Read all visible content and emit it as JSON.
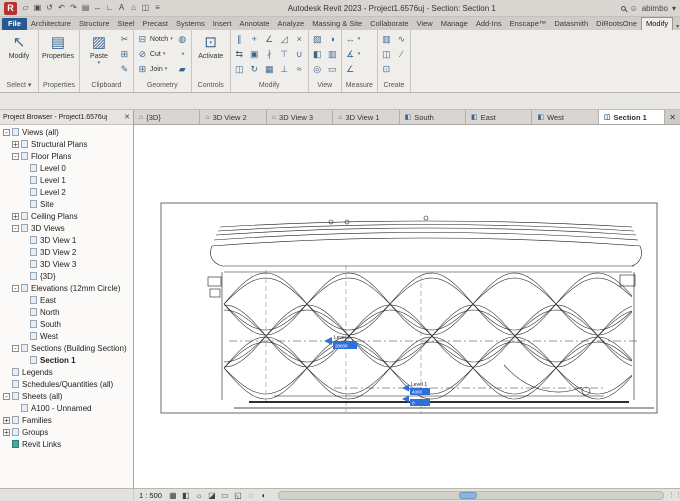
{
  "title_bar": {
    "title": "Autodesk Revit 2023 - Project1.6576uj - Section: Section 1",
    "user": "abimbo",
    "qat_icons": [
      {
        "name": "open-icon",
        "glyph": "▱"
      },
      {
        "name": "save-icon",
        "glyph": "▣"
      },
      {
        "name": "sync-icon",
        "glyph": "↺"
      },
      {
        "name": "undo-icon",
        "glyph": "↶"
      },
      {
        "name": "redo-icon",
        "glyph": "↷"
      },
      {
        "name": "print-icon",
        "glyph": "▤"
      },
      {
        "name": "measure-icon",
        "glyph": "↔"
      },
      {
        "name": "aligned-dimension-icon",
        "glyph": "∟"
      },
      {
        "name": "text-icon",
        "glyph": "A"
      },
      {
        "name": "3d-view-icon",
        "glyph": "⌂"
      },
      {
        "name": "section-icon",
        "glyph": "◫"
      },
      {
        "name": "thin-lines-icon",
        "glyph": "≡"
      }
    ]
  },
  "ribbon": {
    "active_tab": "Modify",
    "tabs": [
      {
        "label": "File",
        "file": true
      },
      {
        "label": "Architecture"
      },
      {
        "label": "Structure"
      },
      {
        "label": "Steel"
      },
      {
        "label": "Precast"
      },
      {
        "label": "Systems"
      },
      {
        "label": "Insert"
      },
      {
        "label": "Annotate"
      },
      {
        "label": "Analyze"
      },
      {
        "label": "Massing & Site"
      },
      {
        "label": "Collaborate"
      },
      {
        "label": "View"
      },
      {
        "label": "Manage"
      },
      {
        "label": "Add-Ins"
      },
      {
        "label": "Enscape™"
      },
      {
        "label": "Datasmith"
      },
      {
        "label": "DiRootsOne"
      },
      {
        "label": "Modify"
      }
    ],
    "panels": [
      {
        "label": "Select",
        "arrow": true,
        "columns": [
          {
            "type": "big",
            "tools": [
              {
                "name": "modify-tool",
                "glyph": "↖",
                "label": "Modify"
              }
            ]
          }
        ]
      },
      {
        "label": "Properties",
        "columns": [
          {
            "type": "big",
            "tools": [
              {
                "name": "properties-tool",
                "glyph": "▤",
                "label": "Properties"
              }
            ]
          }
        ]
      },
      {
        "label": "Clipboard",
        "columns": [
          {
            "type": "big",
            "tools": [
              {
                "name": "paste-tool",
                "glyph": "▨",
                "label": "Paste",
                "arrow": true
              }
            ]
          },
          {
            "type": "stack",
            "tools": [
              {
                "name": "cut-icon",
                "glyph": "✂"
              },
              {
                "name": "copy-icon",
                "glyph": "⊞"
              },
              {
                "name": "match-type-icon",
                "glyph": "✎"
              }
            ]
          }
        ]
      },
      {
        "label": "Geometry",
        "columns": [
          {
            "type": "stack",
            "tools": [
              {
                "name": "notch-tool",
                "glyph": "⊟",
                "label": "Notch",
                "arrow": true
              },
              {
                "name": "cut-geometry-tool",
                "glyph": "⊘",
                "label": "Cut",
                "arrow": true
              },
              {
                "name": "join-geometry-tool",
                "glyph": "⊞",
                "label": "Join",
                "arrow": true
              }
            ]
          },
          {
            "type": "stack",
            "tools": [
              {
                "name": "paint-icon",
                "glyph": "◍"
              },
              {
                "name": "split-face-icon",
                "glyph": "◔"
              },
              {
                "name": "demolish-icon",
                "glyph": "▰"
              }
            ]
          }
        ]
      },
      {
        "label": "Controls",
        "columns": [
          {
            "type": "big",
            "tools": [
              {
                "name": "activate-controls-tool",
                "glyph": "⊡",
                "label": "Activate"
              }
            ]
          }
        ]
      },
      {
        "label": "Modify",
        "columns": [
          {
            "type": "stack",
            "tools": [
              {
                "name": "align-icon",
                "glyph": "∥"
              },
              {
                "name": "offset-icon",
                "glyph": "⇆"
              },
              {
                "name": "mirror-icon",
                "glyph": "◫"
              }
            ]
          },
          {
            "type": "stack",
            "tools": [
              {
                "name": "move-icon",
                "glyph": "+"
              },
              {
                "name": "copy-element-icon",
                "glyph": "▣"
              },
              {
                "name": "rotate-icon",
                "glyph": "↻"
              }
            ]
          },
          {
            "type": "stack",
            "tools": [
              {
                "name": "trim-icon",
                "glyph": "∠"
              },
              {
                "name": "split-element-icon",
                "glyph": "∤"
              },
              {
                "name": "array-icon",
                "glyph": "▦"
              }
            ]
          },
          {
            "type": "stack",
            "tools": [
              {
                "name": "scale-icon",
                "glyph": "◿"
              },
              {
                "name": "pin-icon",
                "glyph": "⊤"
              },
              {
                "name": "unpin-icon",
                "glyph": "⊥"
              }
            ]
          },
          {
            "type": "stack",
            "tools": [
              {
                "name": "delete-icon",
                "glyph": "×"
              },
              {
                "name": "join-unjoin-icon",
                "glyph": "∪"
              },
              {
                "name": "match-icon",
                "glyph": "≈"
              }
            ]
          }
        ]
      },
      {
        "label": "View",
        "columns": [
          {
            "type": "stack",
            "tools": [
              {
                "name": "hidden-lines-icon",
                "glyph": "▨"
              },
              {
                "name": "cutaway-icon",
                "glyph": "◧"
              },
              {
                "name": "camera-icon",
                "glyph": "◎"
              }
            ]
          },
          {
            "type": "stack",
            "tools": [
              {
                "name": "render-icon",
                "glyph": "◑"
              },
              {
                "name": "views-icon",
                "glyph": "▥"
              },
              {
                "name": "close-hidden-windows-icon",
                "glyph": "▭"
              }
            ]
          }
        ]
      },
      {
        "label": "Measure",
        "columns": [
          {
            "type": "stack",
            "tools": [
              {
                "name": "measure-tool",
                "glyph": "↔",
                "arrow": true
              },
              {
                "name": "aligned-dimension-tool",
                "glyph": "∡",
                "arrow": true
              },
              {
                "name": "angle-dimension-tool",
                "glyph": "∠"
              }
            ]
          }
        ]
      },
      {
        "label": "Create",
        "columns": [
          {
            "type": "stack",
            "tools": [
              {
                "name": "create-parts-icon",
                "glyph": "▥"
              },
              {
                "name": "create-assembly-icon",
                "glyph": "◫"
              },
              {
                "name": "create-group-icon",
                "glyph": "⊡"
              }
            ]
          },
          {
            "type": "stack",
            "tools": [
              {
                "name": "insulation-icon",
                "glyph": "∿"
              },
              {
                "name": "detail-line-icon",
                "glyph": "∕"
              }
            ]
          }
        ]
      }
    ]
  },
  "view_tabs": {
    "active": "Section 1",
    "close_glyph": "✕",
    "tabs": [
      {
        "label": "{3D}",
        "icon": "3d-view-icon",
        "glyph": "⌂"
      },
      {
        "label": "3D View 2",
        "icon": "3d-view-icon",
        "glyph": "⌂"
      },
      {
        "label": "3D View 3",
        "icon": "3d-view-icon",
        "glyph": "⌂"
      },
      {
        "label": "3D View 1",
        "icon": "3d-view-icon",
        "glyph": "⌂"
      },
      {
        "label": "South",
        "icon": "elevation-icon",
        "glyph": "◧"
      },
      {
        "label": "East",
        "icon": "elevation-icon",
        "glyph": "◧"
      },
      {
        "label": "West",
        "icon": "elevation-icon",
        "glyph": "◧"
      },
      {
        "label": "Section 1",
        "icon": "section-icon",
        "glyph": "◫"
      }
    ]
  },
  "project_browser": {
    "header": "Project Browser - Project1.6576uj",
    "close_glyph": "✕",
    "items": [
      {
        "label": "Views (all)",
        "indent": 0,
        "toggle": "minus"
      },
      {
        "label": "Structural Plans",
        "indent": 1,
        "toggle": "plus"
      },
      {
        "label": "Floor Plans",
        "indent": 1,
        "toggle": "minus"
      },
      {
        "label": "Level 0",
        "indent": 2
      },
      {
        "label": "Level 1",
        "indent": 2
      },
      {
        "label": "Level 2",
        "indent": 2
      },
      {
        "label": "Site",
        "indent": 2
      },
      {
        "label": "Ceiling Plans",
        "indent": 1,
        "toggle": "plus"
      },
      {
        "label": "3D Views",
        "indent": 1,
        "toggle": "minus"
      },
      {
        "label": "3D View 1",
        "indent": 2
      },
      {
        "label": "3D View 2",
        "indent": 2
      },
      {
        "label": "3D View 3",
        "indent": 2
      },
      {
        "label": "{3D}",
        "indent": 2
      },
      {
        "label": "Elevations (12mm Circle)",
        "indent": 1,
        "toggle": "minus"
      },
      {
        "label": "East",
        "indent": 2
      },
      {
        "label": "North",
        "indent": 2
      },
      {
        "label": "South",
        "indent": 2
      },
      {
        "label": "West",
        "indent": 2
      },
      {
        "label": "Sections (Building Section)",
        "indent": 1,
        "toggle": "minus"
      },
      {
        "label": "Section 1",
        "indent": 2,
        "bold": true
      },
      {
        "label": "Legends",
        "indent": 0
      },
      {
        "label": "Schedules/Quantities (all)",
        "indent": 0
      },
      {
        "label": "Sheets (all)",
        "indent": 0,
        "toggle": "minus"
      },
      {
        "label": "A100 - Unnamed",
        "indent": 1
      },
      {
        "label": "Families",
        "indent": 0,
        "toggle": "plus"
      },
      {
        "label": "Groups",
        "indent": 0,
        "toggle": "plus"
      },
      {
        "label": "Revit Links",
        "indent": 0,
        "teal": true
      }
    ]
  },
  "drawing": {
    "levels": [
      {
        "name": "Level 2",
        "elevation": "28000"
      },
      {
        "name": "Level 1",
        "elevation": "4000"
      },
      {
        "name": "Level 0",
        "elevation": "0"
      }
    ]
  },
  "view_control_bar": {
    "scale": "1 : 500",
    "icons": [
      {
        "name": "detail-level-icon",
        "glyph": "▦"
      },
      {
        "name": "visual-style-icon",
        "glyph": "◧"
      },
      {
        "name": "sun-path-icon",
        "glyph": "☼"
      },
      {
        "name": "shadows-icon",
        "glyph": "◪"
      },
      {
        "name": "crop-view-icon",
        "glyph": "▭"
      },
      {
        "name": "show-crop-region-icon",
        "glyph": "◱"
      },
      {
        "name": "temporary-hide-icon",
        "glyph": "◌"
      },
      {
        "name": "reveal-hidden-icon",
        "glyph": "◐"
      }
    ]
  }
}
